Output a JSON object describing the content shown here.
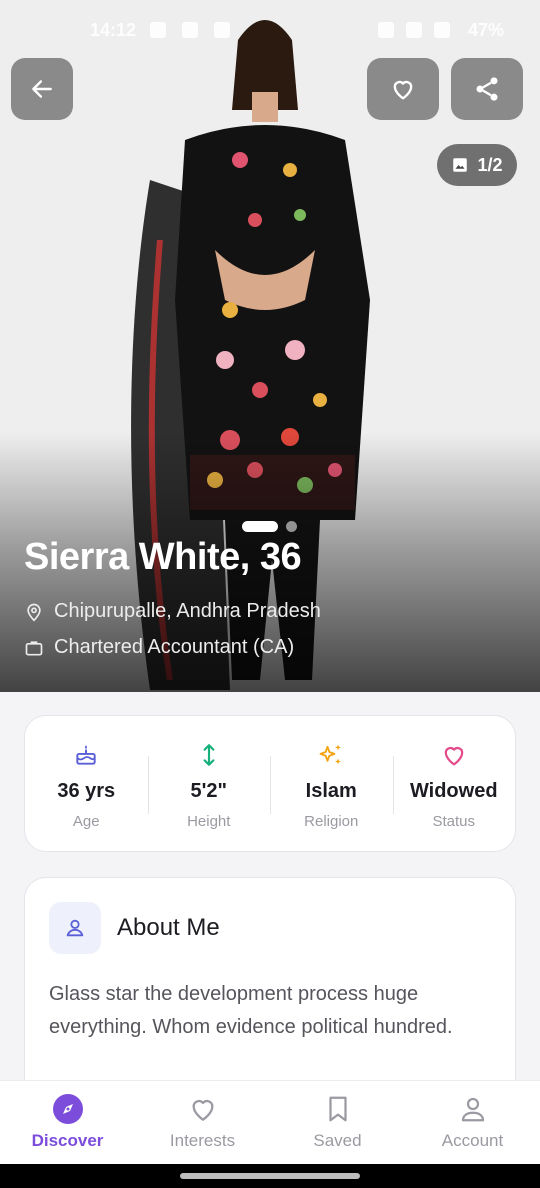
{
  "status_bar": {
    "time": "14:12",
    "battery": "47%"
  },
  "profile": {
    "photo_counter": "1/2",
    "name_age": "Sierra White, 36",
    "location": "Chipurupalle, Andhra Pradesh",
    "profession": "Chartered Accountant (CA)"
  },
  "stats": [
    {
      "value": "36 yrs",
      "label": "Age",
      "icon": "birthday-cake-icon",
      "color": "#5b5fd6"
    },
    {
      "value": "5'2\"",
      "label": "Height",
      "icon": "vertical-arrows-icon",
      "color": "#16b07a"
    },
    {
      "value": "Islam",
      "label": "Religion",
      "icon": "sparkle-icon",
      "color": "#f2a313"
    },
    {
      "value": "Widowed",
      "label": "Status",
      "icon": "heart-outline-icon",
      "color": "#e34b8a"
    }
  ],
  "about": {
    "title": "About Me",
    "text": "Glass star the development process huge everything. Whom evidence political hundred."
  },
  "nav": [
    {
      "label": "Discover",
      "icon": "compass-icon",
      "active": true
    },
    {
      "label": "Interests",
      "icon": "heart-icon",
      "active": false
    },
    {
      "label": "Saved",
      "icon": "bookmark-icon",
      "active": false
    },
    {
      "label": "Account",
      "icon": "user-icon",
      "active": false
    }
  ],
  "colors": {
    "accent": "#7c4ddb",
    "muted": "#9a9aa2"
  }
}
